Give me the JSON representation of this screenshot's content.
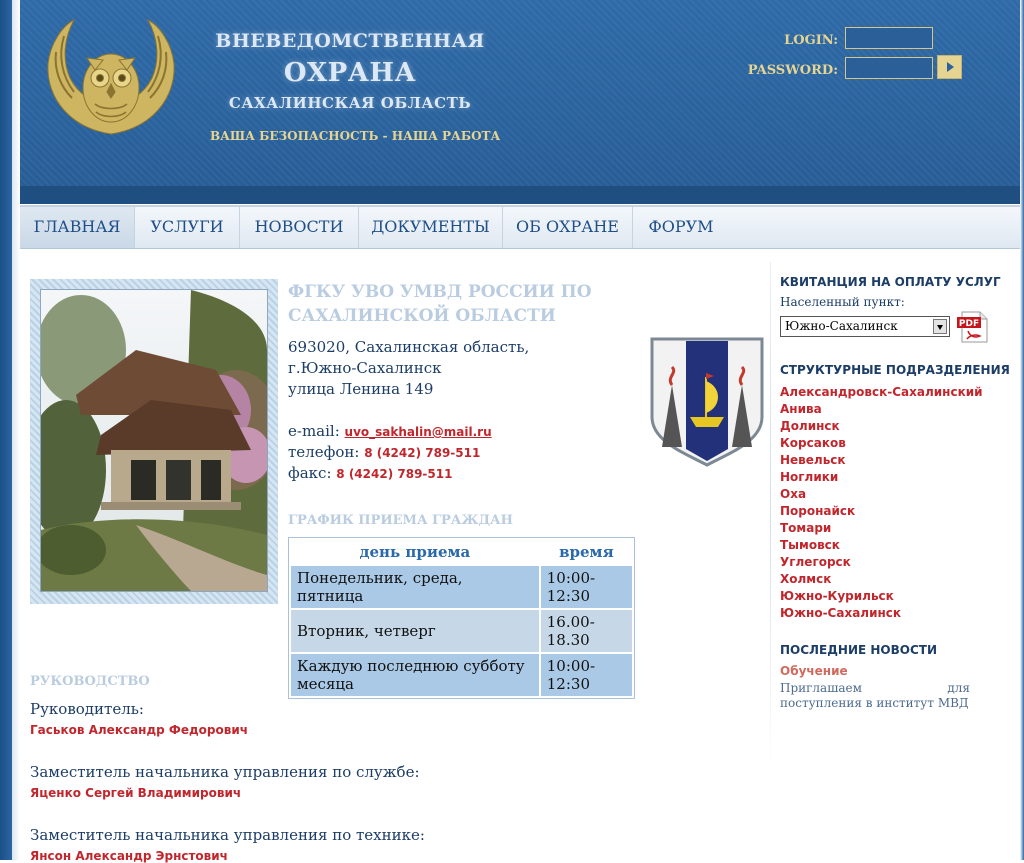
{
  "header": {
    "brand_line_1": "ВНЕВЕДОМСТВЕННАЯ",
    "brand_line_2": "ОХРАНА",
    "brand_line_3": "САХАЛИНСКАЯ ОБЛАСТЬ",
    "slogan": "ВАША БЕЗОПАСНОСТЬ - НАША РАБОТА",
    "login_label": "LOGIN:",
    "password_label": "PASSWORD:",
    "login_value": "",
    "password_value": ""
  },
  "nav": {
    "items": [
      {
        "label": "ГЛАВНАЯ",
        "active": true
      },
      {
        "label": "УСЛУГИ",
        "active": false
      },
      {
        "label": "НОВОСТИ",
        "active": false
      },
      {
        "label": "ДОКУМЕНТЫ",
        "active": false
      },
      {
        "label": "ОБ ОХРАНЕ",
        "active": false
      },
      {
        "label": "ФОРУМ",
        "active": false
      }
    ]
  },
  "org": {
    "title": "ФГКУ УВО УМВД РОССИИ ПО САХАЛИНСКОЙ ОБЛАСТИ",
    "address_1": "693020, Сахалинская область,",
    "address_2": "г.Южно-Сахалинск",
    "address_3": "улица Ленина 149",
    "email_label": "e-mail:",
    "email": "uvo_sakhalin@mail.ru",
    "phone_label": "телефон:",
    "phone": "8 (4242) 789-511",
    "fax_label": "факс:",
    "fax": "8 (4242) 789-511"
  },
  "schedule": {
    "title": "ГРАФИК ПРИЕМА ГРАЖДАН",
    "col_day": "день приема",
    "col_time": "время",
    "rows": [
      {
        "day": "Понедельник, среда, пятница",
        "time": "10:00-12:30"
      },
      {
        "day": "Вторник, четверг",
        "time": "16.00-18.30"
      },
      {
        "day": "Каждую последнюю субботу месяца",
        "time": "10:00-12:30"
      }
    ]
  },
  "management": {
    "title": "РУКОВОДСТВО",
    "people": [
      {
        "role": "Руководитель:",
        "name": "Гаськов Александр Федорович"
      },
      {
        "role": "Заместитель начальника управления по службе:",
        "name": "Яценко Сергей Владимирович"
      },
      {
        "role": "Заместитель начальника управления по технике:",
        "name": "Янсон Александр Эрнстович"
      }
    ]
  },
  "sidebar": {
    "receipt_heading": "КВИТАНЦИЯ НА ОПЛАТУ УСЛУГ",
    "locality_label": "Населенный пункт:",
    "locality_selected": "Южно-Сахалинск",
    "divisions_heading": "СТРУКТУРНЫЕ ПОДРАЗДЕЛЕНИЯ",
    "divisions": [
      "Александровск-Сахалинский",
      "Анива",
      "Долинск",
      "Корсаков",
      "Невельск",
      "Ноглики",
      "Оха",
      "Поронайск",
      "Томари",
      "Тымовск",
      "Углегорск",
      "Холмск",
      "Южно-Курильск",
      "Южно-Сахалинск"
    ],
    "news_heading": "ПОСЛЕДНИЕ НОВОСТИ",
    "news_title": "Обучение",
    "news_text": "Приглашаем для поступления в институт МВД"
  },
  "colors": {
    "header_blue": "#2b66a3",
    "accent_gold": "#e6d592",
    "link_red": "#c0272d",
    "nav_text": "#1f4f86"
  }
}
